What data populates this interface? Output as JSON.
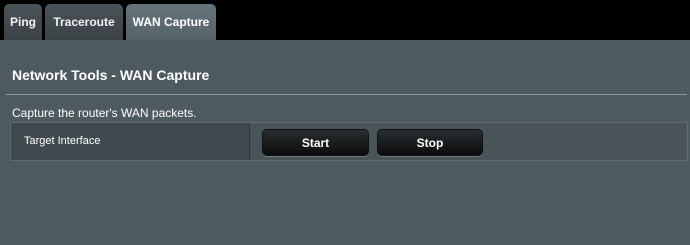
{
  "tabs": [
    {
      "label": "Ping",
      "active": false
    },
    {
      "label": "Traceroute",
      "active": false
    },
    {
      "label": "WAN Capture",
      "active": true
    }
  ],
  "page": {
    "title": "Network Tools - WAN Capture",
    "description": "Capture the router's WAN packets."
  },
  "form": {
    "target_interface_label": "Target Interface",
    "start_label": "Start",
    "stop_label": "Stop"
  },
  "colors": {
    "background": "#000000",
    "panel": "#4d5a5f",
    "active_tab": "#5f6d74",
    "button": "#1a1d1f"
  }
}
